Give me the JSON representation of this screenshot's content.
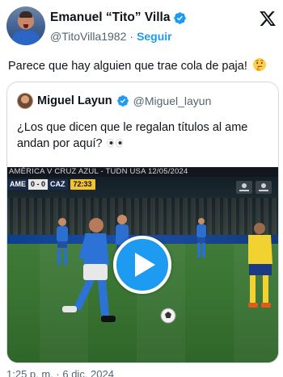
{
  "author": {
    "display_name": "Emanuel “Tito” Villa",
    "handle": "@TitoVilla1982",
    "separator": "·",
    "follow_label": "Seguir"
  },
  "tweet": {
    "text": "Parece que hay alguien que trae cola de paja!",
    "emoji": "thinking-face-emoji"
  },
  "quoted": {
    "display_name": "Miguel Layun",
    "handle": "@Miguel_layun",
    "text": "¿Los que dicen que le regalan títulos al ame andan por aquí?",
    "emoji": "eyes-emoji"
  },
  "video": {
    "banner": "AMÉRICA V CRUZ AZUL - TUDN USA 12/05/2024",
    "scorebug": {
      "home": "AME",
      "score": "0 - 0",
      "away": "CAZ",
      "clock": "72:33"
    },
    "play_icon": "play-icon"
  },
  "footer": {
    "timestamp": "1:25 p. m. · 6 dic. 2024"
  },
  "colors": {
    "accent": "#1d9bf0",
    "text": "#0f1419",
    "secondary": "#536471",
    "border": "#cfd9de"
  }
}
